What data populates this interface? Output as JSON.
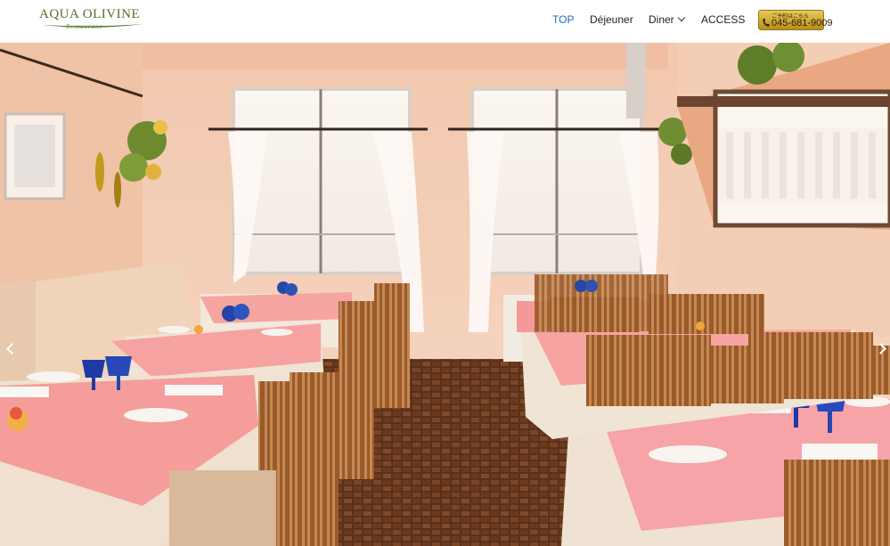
{
  "logo": {
    "name": "AQUA OLIVINE",
    "subtitle": "Restaurant"
  },
  "nav": {
    "items": [
      {
        "label": "TOP",
        "active": true
      },
      {
        "label": "Déjeuner",
        "active": false
      },
      {
        "label": "Diner",
        "active": false,
        "has_dropdown": true
      },
      {
        "label": "ACCESS",
        "active": false
      }
    ]
  },
  "reservation": {
    "label": "ご予約はこちら",
    "phone": "045-681-9009"
  },
  "hero": {
    "description_icon": "restaurant-interior-photo"
  },
  "colors": {
    "nav_active": "#1d6fb8",
    "reserve_gold": "#d4ae3c",
    "logo_green": "#5a6b2a"
  }
}
